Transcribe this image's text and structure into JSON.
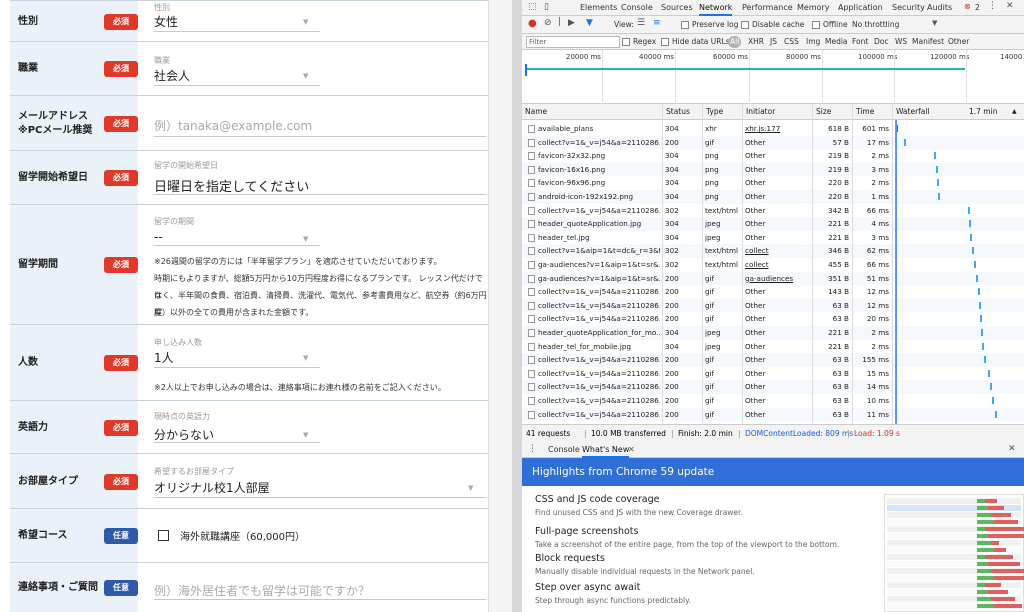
{
  "form": {
    "rows": [
      {
        "label": "性別",
        "badge": "必須",
        "badge_type": "req",
        "small": "性別",
        "value": "女性",
        "kind": "select"
      },
      {
        "label": "職業",
        "badge": "必須",
        "badge_type": "req",
        "small": "職業",
        "value": "社会人",
        "kind": "select"
      },
      {
        "label": "メールアドレス\n※PCメール推奨",
        "badge": "必須",
        "badge_type": "req",
        "small": "",
        "value": "",
        "placeholder": "例）tanaka@example.com",
        "kind": "input"
      },
      {
        "label": "留学開始希望日",
        "badge": "必須",
        "badge_type": "req",
        "small": "留学の開始希望日",
        "value": "日曜日を指定してください",
        "kind": "date"
      },
      {
        "label": "留学期間",
        "badge": "必須",
        "badge_type": "req",
        "small": "留学の期間",
        "value": "--",
        "kind": "select",
        "note": [
          "※26週間の留学の方には「半年留学プラン」を適応させていただいております。",
          "時期にもよりますが、総額5万円から10万円程度お得になるプランです。 レッスン代だけでは",
          "なく、半年間の食費、宿泊費、清掃費、洗濯代、電気代、参考書費用など、航空券（約6万円程",
          "度）以外の全ての費用が含まれた金額です。"
        ]
      },
      {
        "label": "人数",
        "badge": "必須",
        "badge_type": "req",
        "small": "申し込み人数",
        "value": "1人",
        "kind": "select",
        "note": [
          "※2人以上でお申し込みの場合は、連絡事項にお連れ様の名前をご記入ください。"
        ]
      },
      {
        "label": "英語力",
        "badge": "必須",
        "badge_type": "req",
        "small": "現時点の英語力",
        "value": "分からない",
        "kind": "select"
      },
      {
        "label": "お部屋タイプ",
        "badge": "必須",
        "badge_type": "req",
        "small": "希望するお部屋タイプ",
        "value": "オリジナル校1人部屋",
        "kind": "select"
      },
      {
        "label": "希望コース",
        "badge": "任意",
        "badge_type": "opt",
        "small": "",
        "value": "海外就職講座（60,000円）",
        "kind": "checkbox"
      },
      {
        "label": "連絡事項・ご質問",
        "badge": "任意",
        "badge_type": "opt",
        "small": "",
        "value": "",
        "placeholder": "例）海外居住者でも留学は可能ですか？",
        "kind": "input"
      }
    ]
  },
  "devtools": {
    "tabs": [
      "Elements",
      "Console",
      "Sources",
      "Network",
      "Performance",
      "Memory",
      "Application",
      "Security",
      "Audits"
    ],
    "active_tab": "Network",
    "error_count": "2",
    "toolbar": {
      "view": "View:",
      "preserve_log": "Preserve log",
      "disable_cache": "Disable cache",
      "offline": "Offline",
      "throttle": "No throttling"
    },
    "filter": {
      "placeholder": "Filter",
      "regex": "Regex",
      "hide_data_urls": "Hide data URLs",
      "types": [
        "All",
        "XHR",
        "JS",
        "CSS",
        "Img",
        "Media",
        "Font",
        "Doc",
        "WS",
        "Manifest",
        "Other"
      ]
    },
    "timeline_ticks": [
      "20000 ms",
      "40000 ms",
      "60000 ms",
      "80000 ms",
      "100000 ms",
      "120000 ms",
      "14000"
    ],
    "columns": [
      "Name",
      "Status",
      "Type",
      "Initiator",
      "Size",
      "Time",
      "Waterfall"
    ],
    "waterfall_label": "1.7 min",
    "requests": [
      {
        "name": "available_plans",
        "status": "304",
        "type": "xhr",
        "initiator": "xhr.js:177",
        "size": "618 B",
        "time": "601 ms",
        "link": true
      },
      {
        "name": "collect?v=1&_v=j54&a=2110286...",
        "status": "200",
        "type": "gif",
        "initiator": "Other",
        "size": "57 B",
        "time": "17 ms"
      },
      {
        "name": "favicon-32x32.png",
        "status": "304",
        "type": "png",
        "initiator": "Other",
        "size": "219 B",
        "time": "2 ms"
      },
      {
        "name": "favicon-16x16.png",
        "status": "304",
        "type": "png",
        "initiator": "Other",
        "size": "219 B",
        "time": "3 ms"
      },
      {
        "name": "favicon-96x96.png",
        "status": "304",
        "type": "png",
        "initiator": "Other",
        "size": "220 B",
        "time": "2 ms"
      },
      {
        "name": "android-icon-192x192.png",
        "status": "304",
        "type": "png",
        "initiator": "Other",
        "size": "220 B",
        "time": "1 ms"
      },
      {
        "name": "collect?v=1&_v=j54&a=2110286...",
        "status": "302",
        "type": "text/html",
        "initiator": "Other",
        "size": "342 B",
        "time": "66 ms"
      },
      {
        "name": "header_quoteApplication.jpg",
        "status": "304",
        "type": "jpeg",
        "initiator": "Other",
        "size": "221 B",
        "time": "4 ms"
      },
      {
        "name": "header_tel.jpg",
        "status": "304",
        "type": "jpeg",
        "initiator": "Other",
        "size": "221 B",
        "time": "3 ms"
      },
      {
        "name": "collect?v=1&aip=1&t=dc&_r=3&ti...",
        "status": "302",
        "type": "text/html",
        "initiator": "collect",
        "size": "346 B",
        "time": "62 ms",
        "link": true
      },
      {
        "name": "ga-audiences?v=1&aip=1&t=sr&...",
        "status": "302",
        "type": "text/html",
        "initiator": "collect",
        "size": "455 B",
        "time": "66 ms",
        "link": true
      },
      {
        "name": "ga-audiences?v=1&aip=1&t=sr&...",
        "status": "200",
        "type": "gif",
        "initiator": "ga-audiences",
        "size": "351 B",
        "time": "51 ms",
        "link": true
      },
      {
        "name": "collect?v=1&_v=j54&a=2110286...",
        "status": "200",
        "type": "gif",
        "initiator": "Other",
        "size": "143 B",
        "time": "12 ms"
      },
      {
        "name": "collect?v=1&_v=j54&a=2110286...",
        "status": "200",
        "type": "gif",
        "initiator": "Other",
        "size": "63 B",
        "time": "12 ms"
      },
      {
        "name": "collect?v=1&_v=j54&a=2110286...",
        "status": "200",
        "type": "gif",
        "initiator": "Other",
        "size": "63 B",
        "time": "20 ms"
      },
      {
        "name": "header_quoteApplication_for_mo...",
        "status": "304",
        "type": "jpeg",
        "initiator": "Other",
        "size": "221 B",
        "time": "2 ms"
      },
      {
        "name": "header_tel_for_mobile.jpg",
        "status": "304",
        "type": "jpeg",
        "initiator": "Other",
        "size": "221 B",
        "time": "2 ms"
      },
      {
        "name": "collect?v=1&_v=j54&a=2110286...",
        "status": "200",
        "type": "gif",
        "initiator": "Other",
        "size": "63 B",
        "time": "155 ms"
      },
      {
        "name": "collect?v=1&_v=j54&a=2110286...",
        "status": "200",
        "type": "gif",
        "initiator": "Other",
        "size": "63 B",
        "time": "15 ms"
      },
      {
        "name": "collect?v=1&_v=j54&a=2110286...",
        "status": "200",
        "type": "gif",
        "initiator": "Other",
        "size": "63 B",
        "time": "14 ms"
      },
      {
        "name": "collect?v=1&_v=j54&a=2110286...",
        "status": "200",
        "type": "gif",
        "initiator": "Other",
        "size": "63 B",
        "time": "10 ms"
      },
      {
        "name": "collect?v=1&_v=j54&a=2110286...",
        "status": "200",
        "type": "gif",
        "initiator": "Other",
        "size": "63 B",
        "time": "11 ms"
      }
    ],
    "status_bar": {
      "requests": "41 requests",
      "transferred": "10.0 MB transferred",
      "finish": "Finish: 2.0 min",
      "dcl": "DOMContentLoaded: 809 ms",
      "load": "Load: 1.09 s"
    },
    "drawer_tabs": [
      "Console",
      "What's New"
    ],
    "highlights_title": "Highlights from Chrome 59 update",
    "features": [
      {
        "title": "CSS and JS code coverage",
        "desc": "Find unused CSS and JS with the new Coverage drawer."
      },
      {
        "title": "Full-page screenshots",
        "desc": "Take a screenshot of the entire page, from the top of the viewport to the bottom."
      },
      {
        "title": "Block requests",
        "desc": "Manually disable individual requests in the Network panel."
      },
      {
        "title": "Step over async await",
        "desc": "Step through async functions predictably."
      }
    ]
  }
}
